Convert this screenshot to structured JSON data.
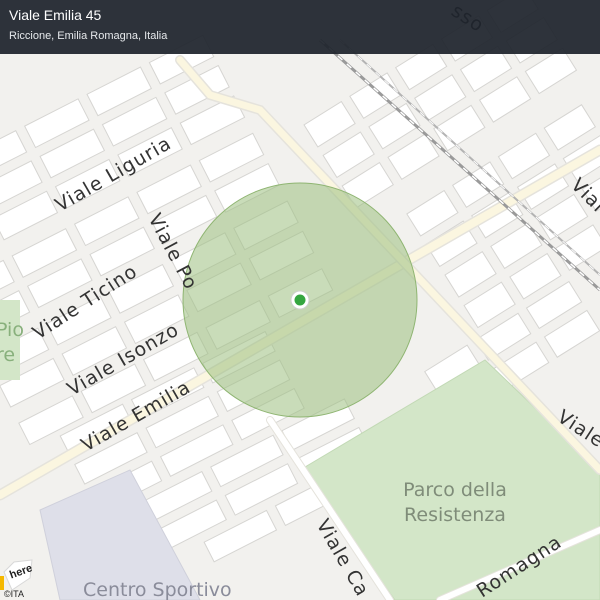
{
  "header": {
    "title": "Viale Emilia 45",
    "subtitle": "Riccione, Emilia Romagna, Italia"
  },
  "map": {
    "streets": {
      "liguria": "Viale  Liguria",
      "po": "Viale  Po",
      "ticino": "Viale Ticino",
      "isonzo": "Viale  Isonzo",
      "emilia": "Viale  Emilia",
      "viale_right": "Viale",
      "viale_right_top": "Viale",
      "viale_bottom": "Viale Ca",
      "romagna": "Romagna",
      "top_fragment": "sso"
    },
    "park": {
      "line1": "Parco della",
      "line2": "Resistenza"
    },
    "sport_center": "Centro Sportivo",
    "left_edge": {
      "line1": "Pio",
      "line2": "re"
    },
    "attribution": "©ITA",
    "logo": "here",
    "colors": {
      "radius_fill": "#9cc07f",
      "marker": "#35a640",
      "park": "#d3e6c8",
      "sport": "#dedfe9",
      "header": "#1e242c"
    }
  }
}
